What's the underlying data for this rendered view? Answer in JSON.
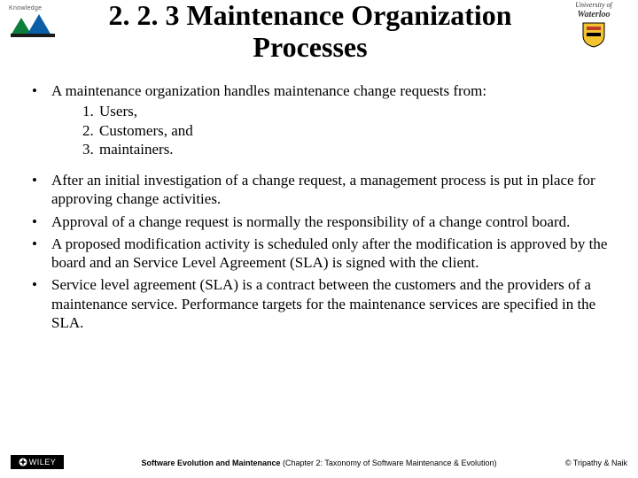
{
  "header": {
    "title": "2. 2. 3 Maintenance Organization Processes",
    "left_logo_label": "Knowledge",
    "right_logo_label": "Waterloo",
    "right_logo_prefix": "University of"
  },
  "body": {
    "items": [
      {
        "text": "A maintenance organization handles maintenance change requests from:",
        "sublist": [
          "Users,",
          "Customers, and",
          "maintainers."
        ]
      },
      {
        "text": "After an initial investigation of a change request, a management process is put in place for approving change activities."
      },
      {
        "text": "Approval of a change request is normally the responsibility of a change control board."
      },
      {
        "text": "A proposed modification activity is scheduled only after the modification is approved by the board and an Service Level Agreement (SLA) is signed with the client."
      },
      {
        "text": "Service level agreement (SLA) is a contract between the customers and the providers of a maintenance service. Performance targets for the maintenance services are specified in the SLA."
      }
    ]
  },
  "footer": {
    "publisher": "WILEY",
    "center_bold": "Software Evolution and Maintenance",
    "center_rest": " (Chapter 2: Taxonomy of Software Maintenance & Evolution)",
    "right": "© Tripathy & Naik"
  }
}
